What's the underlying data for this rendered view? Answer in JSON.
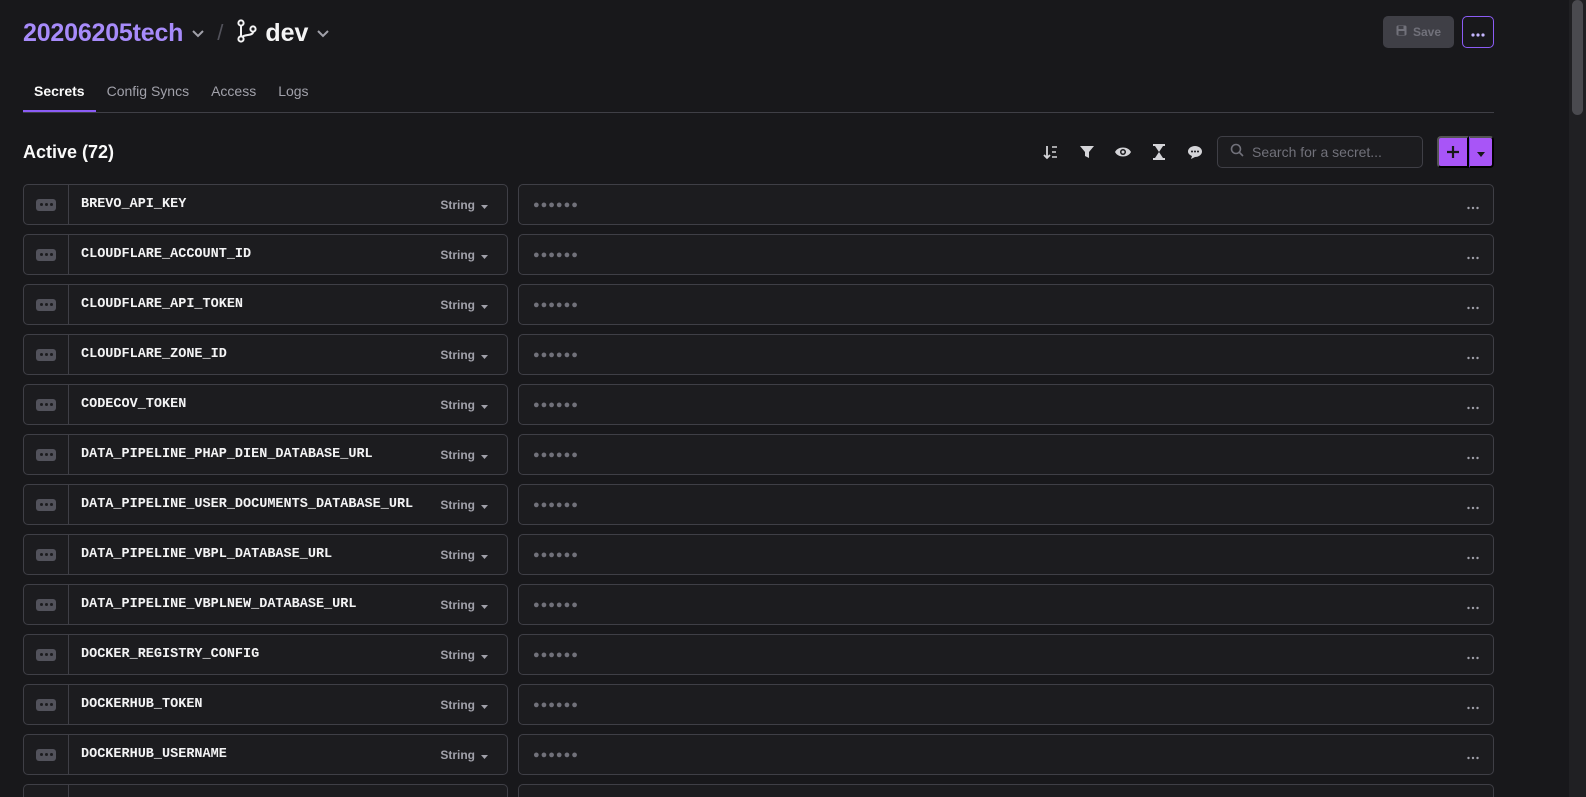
{
  "header": {
    "project": "20206205tech",
    "separator": "/",
    "branch": "dev",
    "save_label": "Save"
  },
  "tabs": [
    {
      "label": "Secrets",
      "active": true
    },
    {
      "label": "Config Syncs",
      "active": false
    },
    {
      "label": "Access",
      "active": false
    },
    {
      "label": "Logs",
      "active": false
    }
  ],
  "toolbar": {
    "title": "Active (72)",
    "search_placeholder": "Search for a secret...",
    "icons": [
      "sort-icon",
      "filter-icon",
      "eye-icon",
      "hourglass-icon",
      "comment-icon"
    ]
  },
  "secrets": [
    {
      "key": "BREVO_API_KEY",
      "type": "String",
      "value": "●●●●●●"
    },
    {
      "key": "CLOUDFLARE_ACCOUNT_ID",
      "type": "String",
      "value": "●●●●●●"
    },
    {
      "key": "CLOUDFLARE_API_TOKEN",
      "type": "String",
      "value": "●●●●●●"
    },
    {
      "key": "CLOUDFLARE_ZONE_ID",
      "type": "String",
      "value": "●●●●●●"
    },
    {
      "key": "CODECOV_TOKEN",
      "type": "String",
      "value": "●●●●●●"
    },
    {
      "key": "DATA_PIPELINE_PHAP_DIEN_DATABASE_URL",
      "type": "String",
      "value": "●●●●●●"
    },
    {
      "key": "DATA_PIPELINE_USER_DOCUMENTS_DATABASE_URL",
      "type": "String",
      "value": "●●●●●●"
    },
    {
      "key": "DATA_PIPELINE_VBPL_DATABASE_URL",
      "type": "String",
      "value": "●●●●●●"
    },
    {
      "key": "DATA_PIPELINE_VBPLNEW_DATABASE_URL",
      "type": "String",
      "value": "●●●●●●"
    },
    {
      "key": "DOCKER_REGISTRY_CONFIG",
      "type": "String",
      "value": "●●●●●●"
    },
    {
      "key": "DOCKERHUB_TOKEN",
      "type": "String",
      "value": "●●●●●●"
    },
    {
      "key": "DOCKERHUB_USERNAME",
      "type": "String",
      "value": "●●●●●●"
    },
    {
      "key": "",
      "type": "",
      "value": ""
    }
  ],
  "colors": {
    "background": "#18181b",
    "accent": "#a855f7",
    "project_text": "#a78bfa",
    "border": "#3f3f46"
  }
}
